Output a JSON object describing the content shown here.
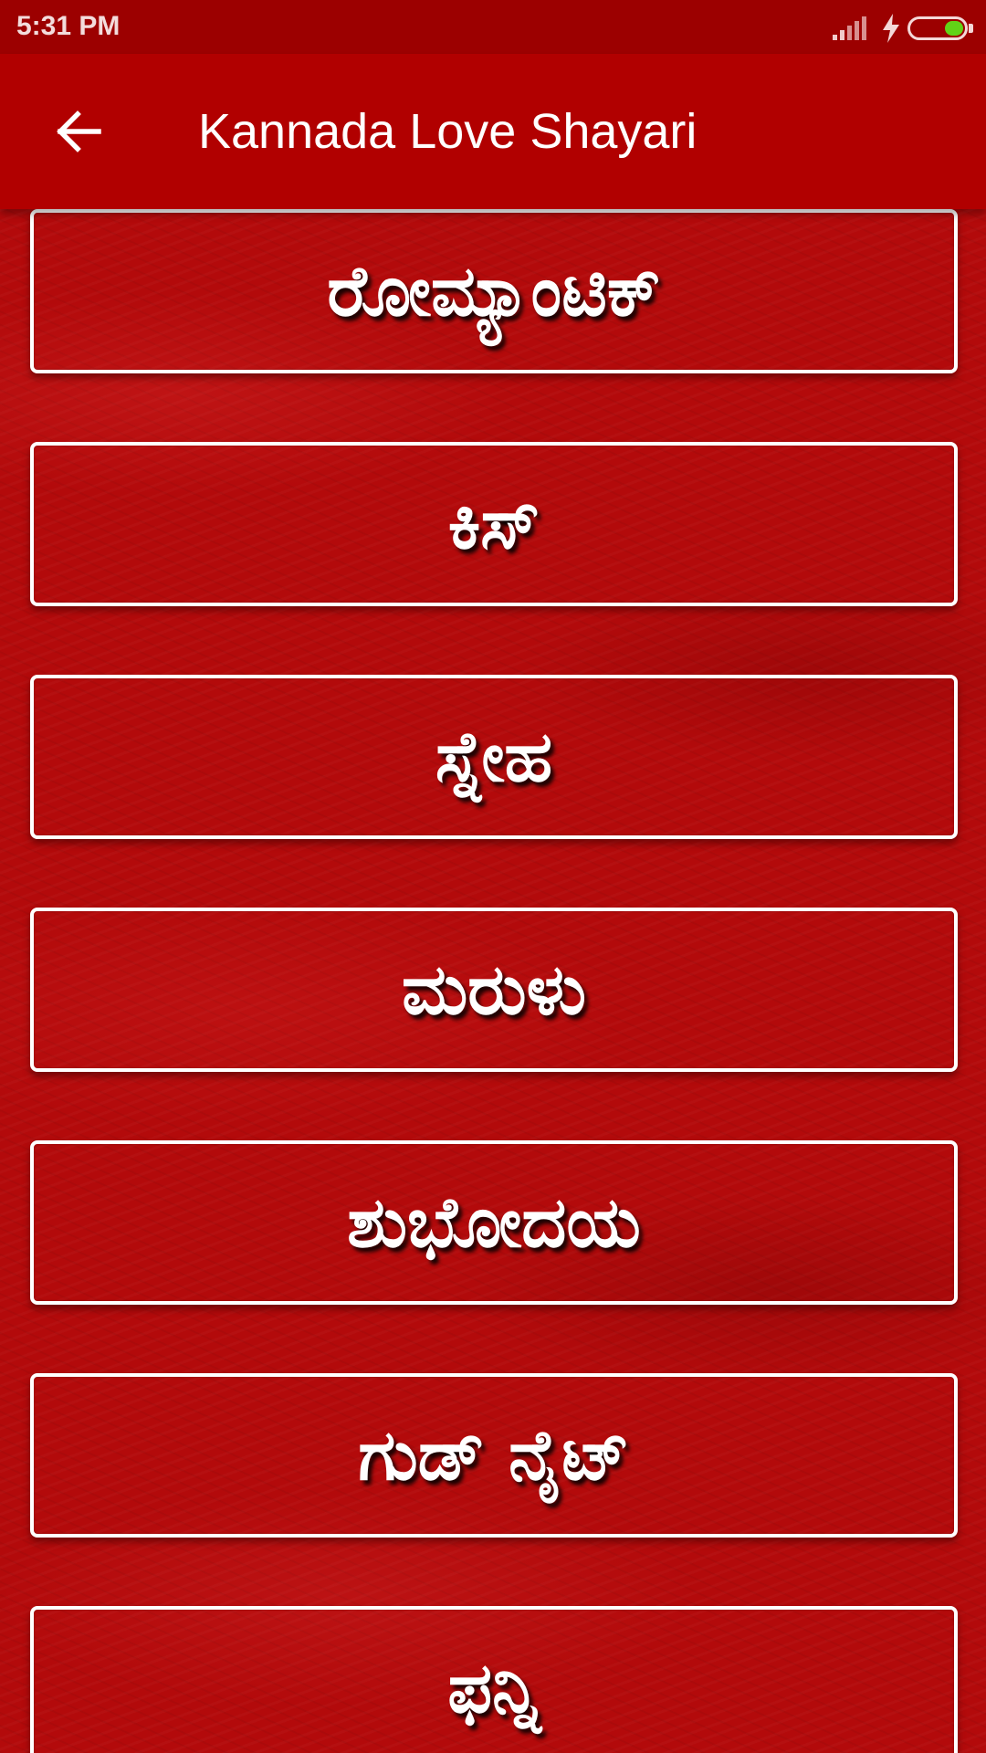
{
  "status_bar": {
    "time": "5:31 PM",
    "icons": [
      "signal-icon",
      "charging-bolt-icon",
      "battery-icon"
    ],
    "battery_color": "#62d317"
  },
  "app_bar": {
    "title": "Kannada Love Shayari",
    "back_icon": "arrow-left-icon",
    "background_color": "#b10000"
  },
  "categories": [
    "ರೋಮ್ಯಾಂಟಿಕ್",
    "ಕಿಸ್",
    "ಸ್ನೇಹ",
    "ಮರುಳು",
    "ಶುಭೋದಯ",
    "ಗುಡ್ ನೈಟ್",
    "ಫನ್ನಿ"
  ]
}
